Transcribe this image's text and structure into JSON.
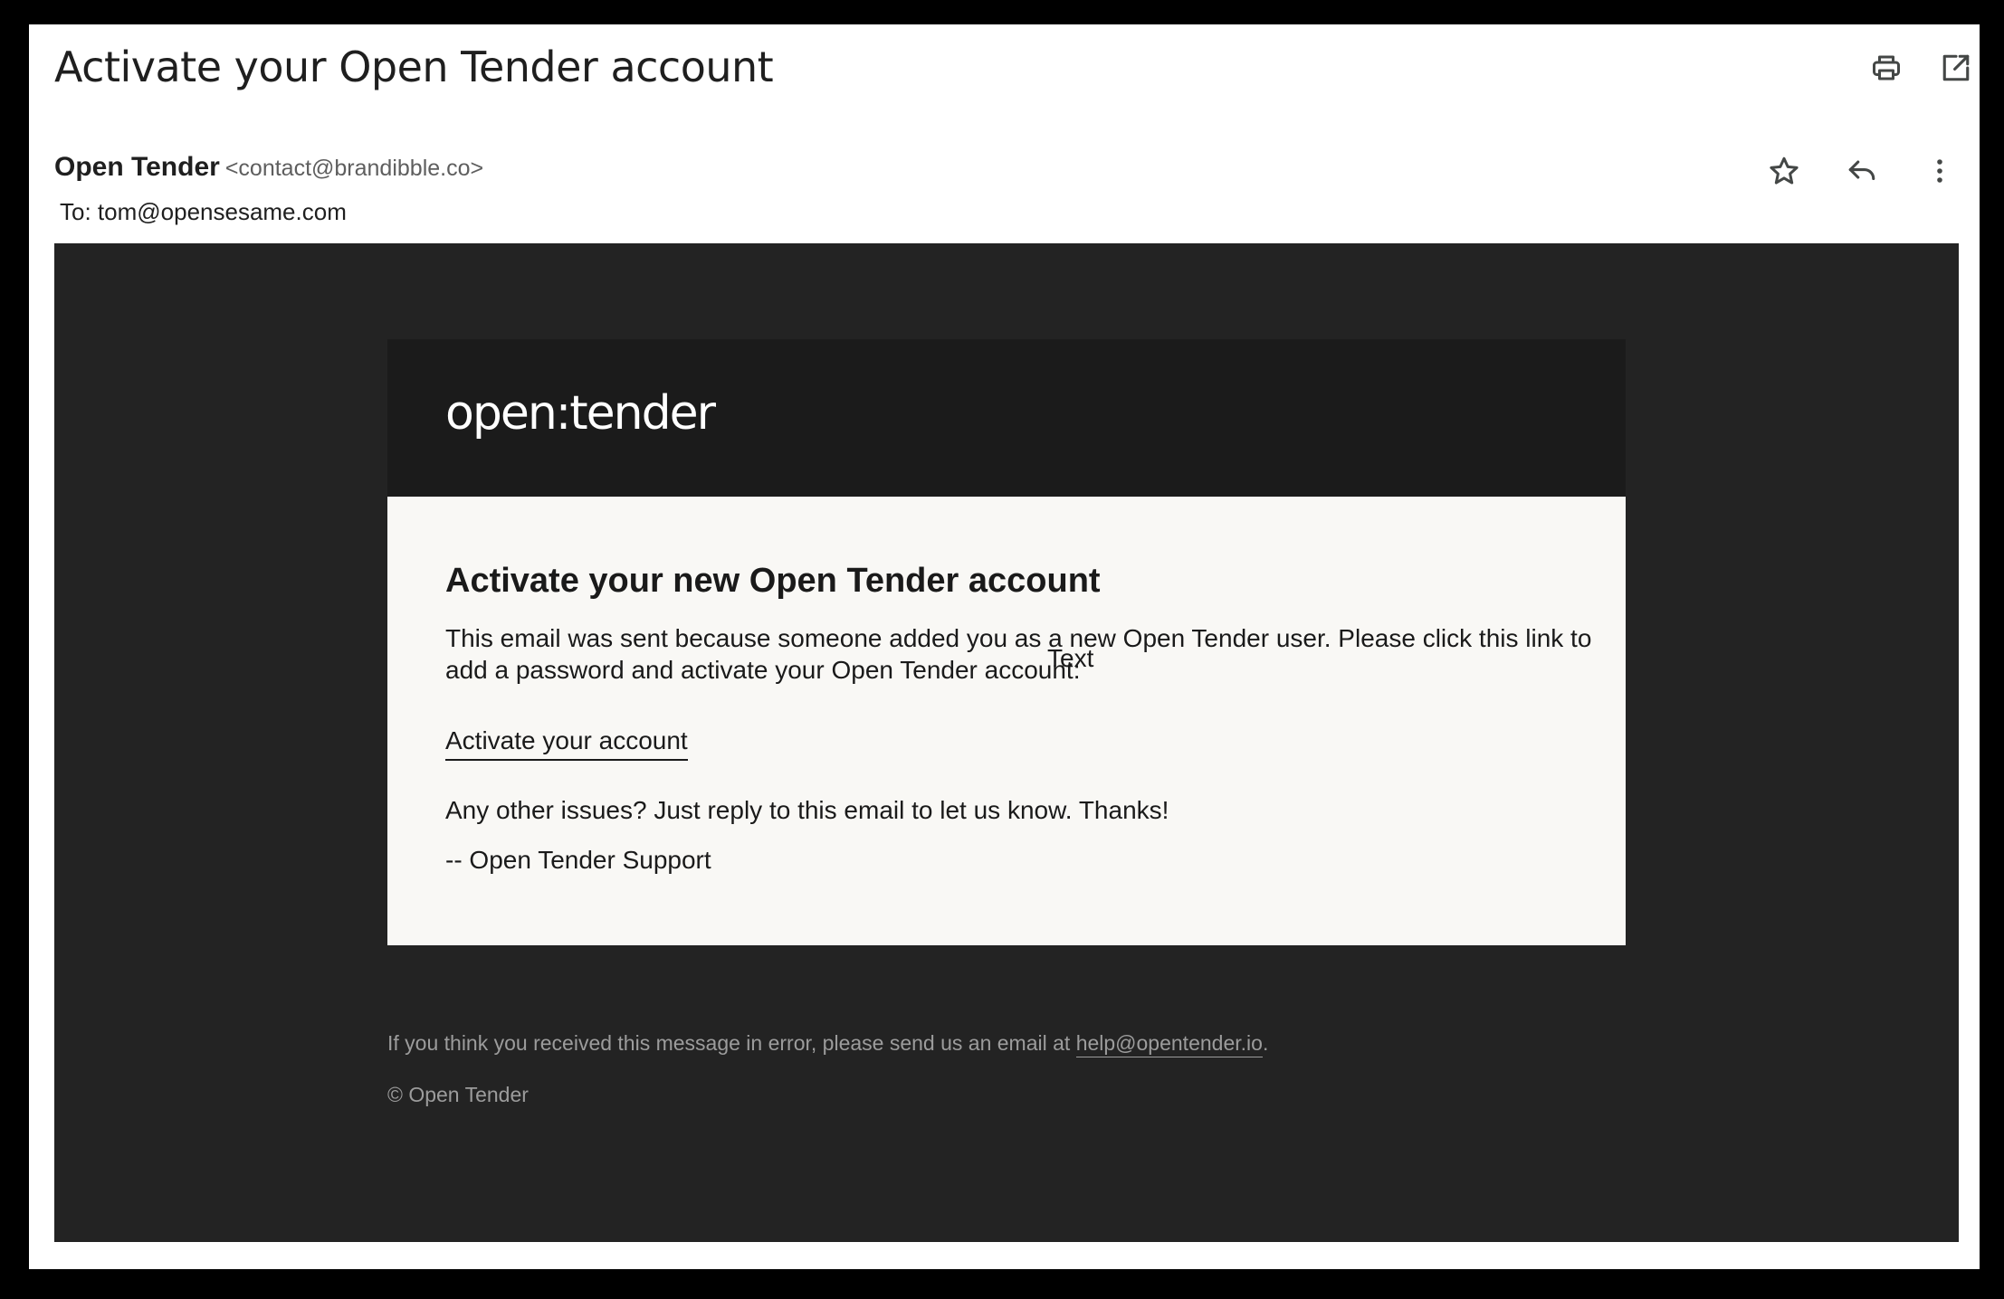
{
  "email": {
    "subject": "Activate your Open Tender account",
    "sender_name": "Open Tender",
    "sender_email": "<contact@brandibble.co>",
    "to_line": "To: tom@opensesame.com"
  },
  "toolbar": {
    "icons": [
      "printer-icon",
      "open-in-new-window-icon",
      "star-icon",
      "reply-icon",
      "more-vertical-icon"
    ]
  },
  "message": {
    "logo_text": "open:tender",
    "heading": "Activate your new Open Tender account",
    "body": "This email was sent because someone added you as a new Open Tender user. Please click this link to add a password and activate your Open Tender account:",
    "stray_label": "Text",
    "activate_link": "Activate your account",
    "issues_text": "Any other issues? Just reply to this email to let us know. Thanks!",
    "signoff": "-- Open Tender Support",
    "footer_prefix": "If you think you received this message in error, please send us an email at ",
    "footer_email": "help@opentender.io",
    "footer_suffix": ".",
    "copyright": "© Open Tender"
  },
  "colors": {
    "canvas_background": "#232323",
    "header_background": "#1b1b1b",
    "card_background": "#f9f8f5",
    "footer_text": "#9c9c9c"
  }
}
